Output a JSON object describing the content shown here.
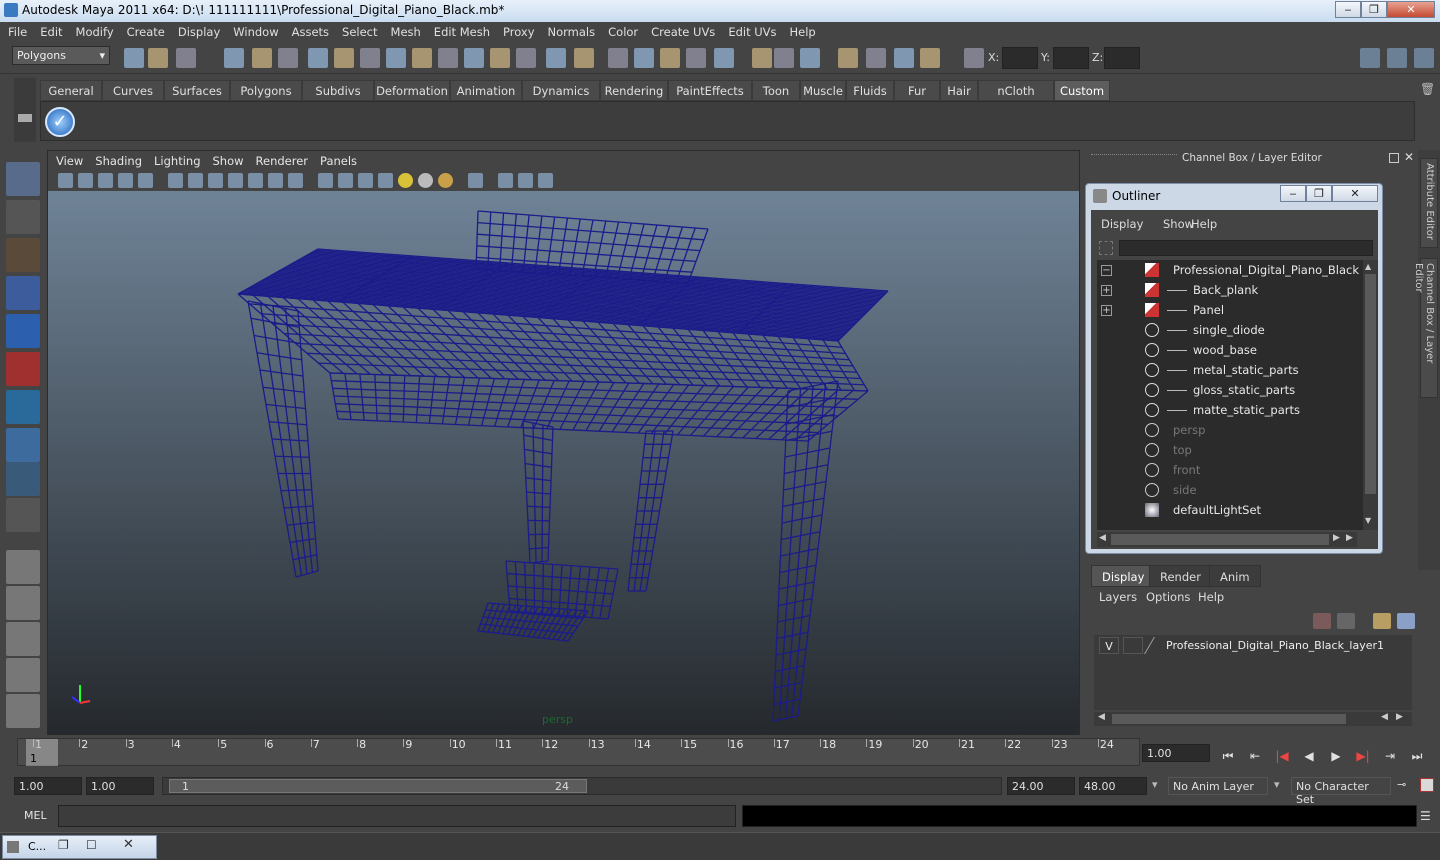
{
  "window": {
    "title": "Autodesk Maya 2011 x64: D:\\! 111111111\\Professional_Digital_Piano_Black.mb*",
    "min_label": "‒",
    "max_label": "❐",
    "close_label": "✕"
  },
  "menubar": [
    "File",
    "Edit",
    "Modify",
    "Create",
    "Display",
    "Window",
    "Assets",
    "Select",
    "Mesh",
    "Edit Mesh",
    "Proxy",
    "Normals",
    "Color",
    "Create UVs",
    "Edit UVs",
    "Help"
  ],
  "status_line": {
    "mode": "Polygons",
    "x_label": "X:",
    "y_label": "Y:",
    "z_label": "Z:",
    "x_value": "",
    "y_value": "",
    "z_value": ""
  },
  "shelf_tabs": [
    "General",
    "Curves",
    "Surfaces",
    "Polygons",
    "Subdivs",
    "Deformation",
    "Animation",
    "Dynamics",
    "Rendering",
    "PaintEffects",
    "Toon",
    "Muscle",
    "Fluids",
    "Fur",
    "Hair",
    "nCloth",
    "Custom"
  ],
  "active_shelf": "Custom",
  "viewport": {
    "menu": [
      "View",
      "Shading",
      "Lighting",
      "Show",
      "Renderer",
      "Panels"
    ],
    "camera_label": "persp",
    "wire_color": "#1b1b8a"
  },
  "channel_box": {
    "title": "Channel Box / Layer Editor"
  },
  "side_tabs": [
    "Attribute Editor",
    "Channel Box / Layer Editor"
  ],
  "outliner": {
    "title": "Outliner",
    "menu": [
      "Display",
      "Show",
      "Help"
    ],
    "items": [
      {
        "label": "Professional_Digital_Piano_Black",
        "expander": "−",
        "icon": "transform-icon",
        "dim": false
      },
      {
        "label": "Back_plank",
        "expander": "+",
        "icon": "transform-icon",
        "dim": false
      },
      {
        "label": "Panel",
        "expander": "+",
        "icon": "transform-icon",
        "dim": false
      },
      {
        "label": "single_diode",
        "expander": "",
        "icon": "mesh-icon",
        "dim": false
      },
      {
        "label": "wood_base",
        "expander": "",
        "icon": "mesh-icon",
        "dim": false
      },
      {
        "label": "metal_static_parts",
        "expander": "",
        "icon": "mesh-icon",
        "dim": false
      },
      {
        "label": "gloss_static_parts",
        "expander": "",
        "icon": "mesh-icon",
        "dim": false
      },
      {
        "label": "matte_static_parts",
        "expander": "",
        "icon": "mesh-icon",
        "dim": false
      },
      {
        "label": "persp",
        "expander": "",
        "icon": "camera-icon",
        "dim": true
      },
      {
        "label": "top",
        "expander": "",
        "icon": "camera-icon",
        "dim": true
      },
      {
        "label": "front",
        "expander": "",
        "icon": "camera-icon",
        "dim": true
      },
      {
        "label": "side",
        "expander": "",
        "icon": "camera-icon",
        "dim": true
      },
      {
        "label": "defaultLightSet",
        "expander": "",
        "icon": "lightset-icon",
        "dim": false
      }
    ]
  },
  "layer_editor": {
    "tabs": [
      "Display",
      "Render",
      "Anim"
    ],
    "active_tab": "Display",
    "menu": [
      "Layers",
      "Options",
      "Help"
    ],
    "layer": {
      "visible": "V",
      "name": "Professional_Digital_Piano_Black_layer1"
    }
  },
  "timeline": {
    "ticks": [
      "1",
      "2",
      "3",
      "4",
      "5",
      "6",
      "7",
      "8",
      "9",
      "10",
      "11",
      "12",
      "13",
      "14",
      "15",
      "16",
      "17",
      "18",
      "19",
      "20",
      "21",
      "22",
      "23",
      "24"
    ],
    "current_frame_marker": "1",
    "current_time": "1.00"
  },
  "range": {
    "start_anim": "1.00",
    "start_play": "1.00",
    "slider_start": "1",
    "slider_end": "24",
    "end_play": "24.00",
    "end_anim": "48.00",
    "anim_layer": "No Anim Layer",
    "character_set": "No Character Set"
  },
  "command": {
    "label": "MEL",
    "value": ""
  },
  "taskbar": {
    "item": "C..."
  }
}
